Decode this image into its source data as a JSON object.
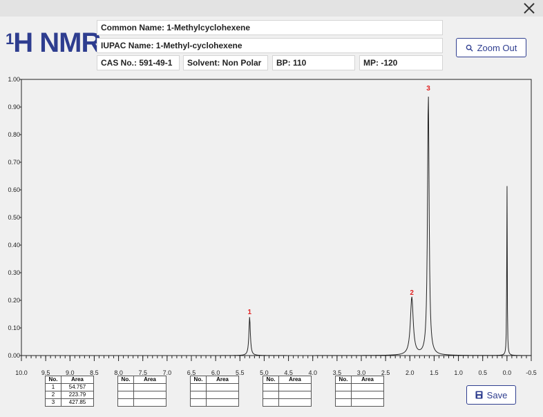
{
  "window": {
    "close_icon": "close-icon"
  },
  "title": {
    "sup": "1",
    "main": "H NMR"
  },
  "info": {
    "common_name": "Common Name: 1-Methylcyclohexene",
    "iupac_name": "IUPAC Name: 1-Methyl-cyclohexene",
    "cas": "CAS No.: 591-49-1",
    "solvent": "Solvent: Non Polar",
    "bp": "BP: 110",
    "mp": "MP: -120"
  },
  "buttons": {
    "zoom_out": "Zoom Out",
    "zoom_icon": "search-icon",
    "save": "Save",
    "save_icon": "save-icon"
  },
  "chart_data": {
    "type": "line",
    "x_label_ticks": [
      "10.0",
      "9.5",
      "9.0",
      "8.5",
      "8.0",
      "7.5",
      "7.0",
      "6.5",
      "6.0",
      "5.5",
      "5.0",
      "4.5",
      "4.0",
      "3.5",
      "3.0",
      "2.5",
      "2.0",
      "1.5",
      "1.0",
      "0.5",
      "0.0",
      "-0.5"
    ],
    "x_ticks": [
      10.0,
      9.5,
      9.0,
      8.5,
      8.0,
      7.5,
      7.0,
      6.5,
      6.0,
      5.5,
      5.0,
      4.5,
      4.0,
      3.5,
      3.0,
      2.5,
      2.0,
      1.5,
      1.0,
      0.5,
      0.0,
      -0.5
    ],
    "y_tick_labels": [
      "0.00",
      "0.10",
      "0.20",
      "0.30",
      "0.40",
      "0.50",
      "0.60",
      "0.70",
      "0.80",
      "0.90",
      "1.00"
    ],
    "y_ticks": [
      0,
      0.1,
      0.2,
      0.3,
      0.4,
      0.5,
      0.6,
      0.7,
      0.8,
      0.9,
      1.0
    ],
    "xlim": [
      10.0,
      -0.5
    ],
    "ylim": [
      0,
      1.0
    ],
    "reversed_x": true,
    "peaks": [
      {
        "label": "1",
        "ppm": 5.3,
        "height": 0.14
      },
      {
        "label": "2",
        "ppm": 1.96,
        "height": 0.21
      },
      {
        "label": "3",
        "ppm": 1.62,
        "height": 0.95
      },
      {
        "label": "",
        "ppm": 0.0,
        "height": 0.64
      }
    ],
    "peak_label_color": "#e02020",
    "line_color": "#222222"
  },
  "tables": [
    {
      "headers": [
        "No.",
        "Area"
      ],
      "rows": [
        [
          "1",
          "54.757"
        ],
        [
          "2",
          "223.79"
        ],
        [
          "3",
          "427.85"
        ]
      ]
    },
    {
      "headers": [
        "No.",
        "Area"
      ],
      "rows": [
        [
          "",
          ""
        ],
        [
          "",
          ""
        ],
        [
          "",
          ""
        ]
      ]
    },
    {
      "headers": [
        "No.",
        "Area"
      ],
      "rows": [
        [
          "",
          ""
        ],
        [
          "",
          ""
        ],
        [
          "",
          ""
        ]
      ]
    },
    {
      "headers": [
        "No.",
        "Area"
      ],
      "rows": [
        [
          "",
          ""
        ],
        [
          "",
          ""
        ],
        [
          "",
          ""
        ]
      ]
    },
    {
      "headers": [
        "No.",
        "Area"
      ],
      "rows": [
        [
          "",
          ""
        ],
        [
          "",
          ""
        ],
        [
          "",
          ""
        ]
      ]
    }
  ]
}
